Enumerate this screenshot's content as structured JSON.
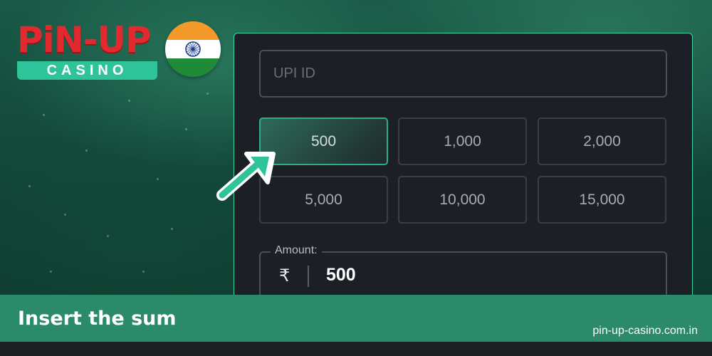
{
  "logo": {
    "wordmark": "PiN-UP",
    "subtitle": "CASINO"
  },
  "flag": {
    "country_icon": "india-flag-icon"
  },
  "form": {
    "upi_placeholder": "UPI ID",
    "amount_options": [
      "500",
      "1,000",
      "2,000",
      "5,000",
      "10,000",
      "15,000"
    ],
    "selected_amount": "500",
    "amount_label": "Amount:",
    "currency_symbol": "₹",
    "amount_value": "500"
  },
  "caption": "Insert the sum",
  "site_url": "pin-up-casino.com.in",
  "colors": {
    "accent": "#2fc39a",
    "panel": "#1c1f26",
    "logo_red": "#e1292f",
    "caption_bar": "#2b8a6a"
  }
}
